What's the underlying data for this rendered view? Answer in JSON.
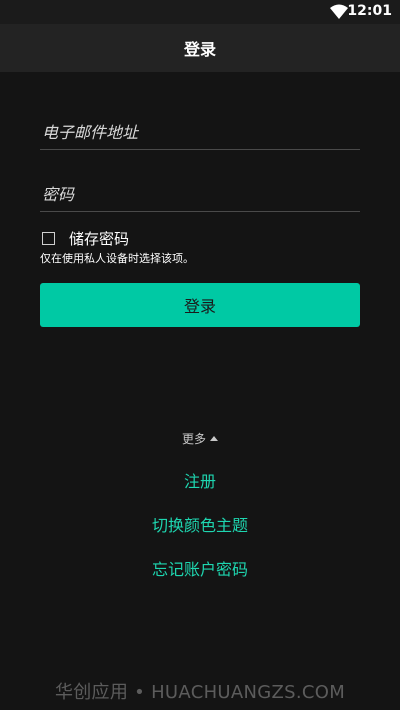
{
  "status_bar": {
    "time": "12:01",
    "wifi_icon": "wifi-icon"
  },
  "app_bar": {
    "title": "登录"
  },
  "form": {
    "email_placeholder": "电子邮件地址",
    "email_value": "",
    "password_placeholder": "密码",
    "password_value": "",
    "remember_label": "储存密码",
    "remember_checked": false,
    "remember_hint": "仅在使用私人设备时选择该项。",
    "login_button": "登录"
  },
  "more": {
    "label": "更多"
  },
  "links": {
    "register": "注册",
    "switch_theme": "切换颜色主题",
    "forgot_password": "忘记账户密码"
  },
  "watermark": "华创应用 • HUACHUANGZS.COM",
  "colors": {
    "accent": "#00c9a4",
    "link": "#1ed6b0",
    "background": "#141414",
    "app_bar": "#232323"
  }
}
